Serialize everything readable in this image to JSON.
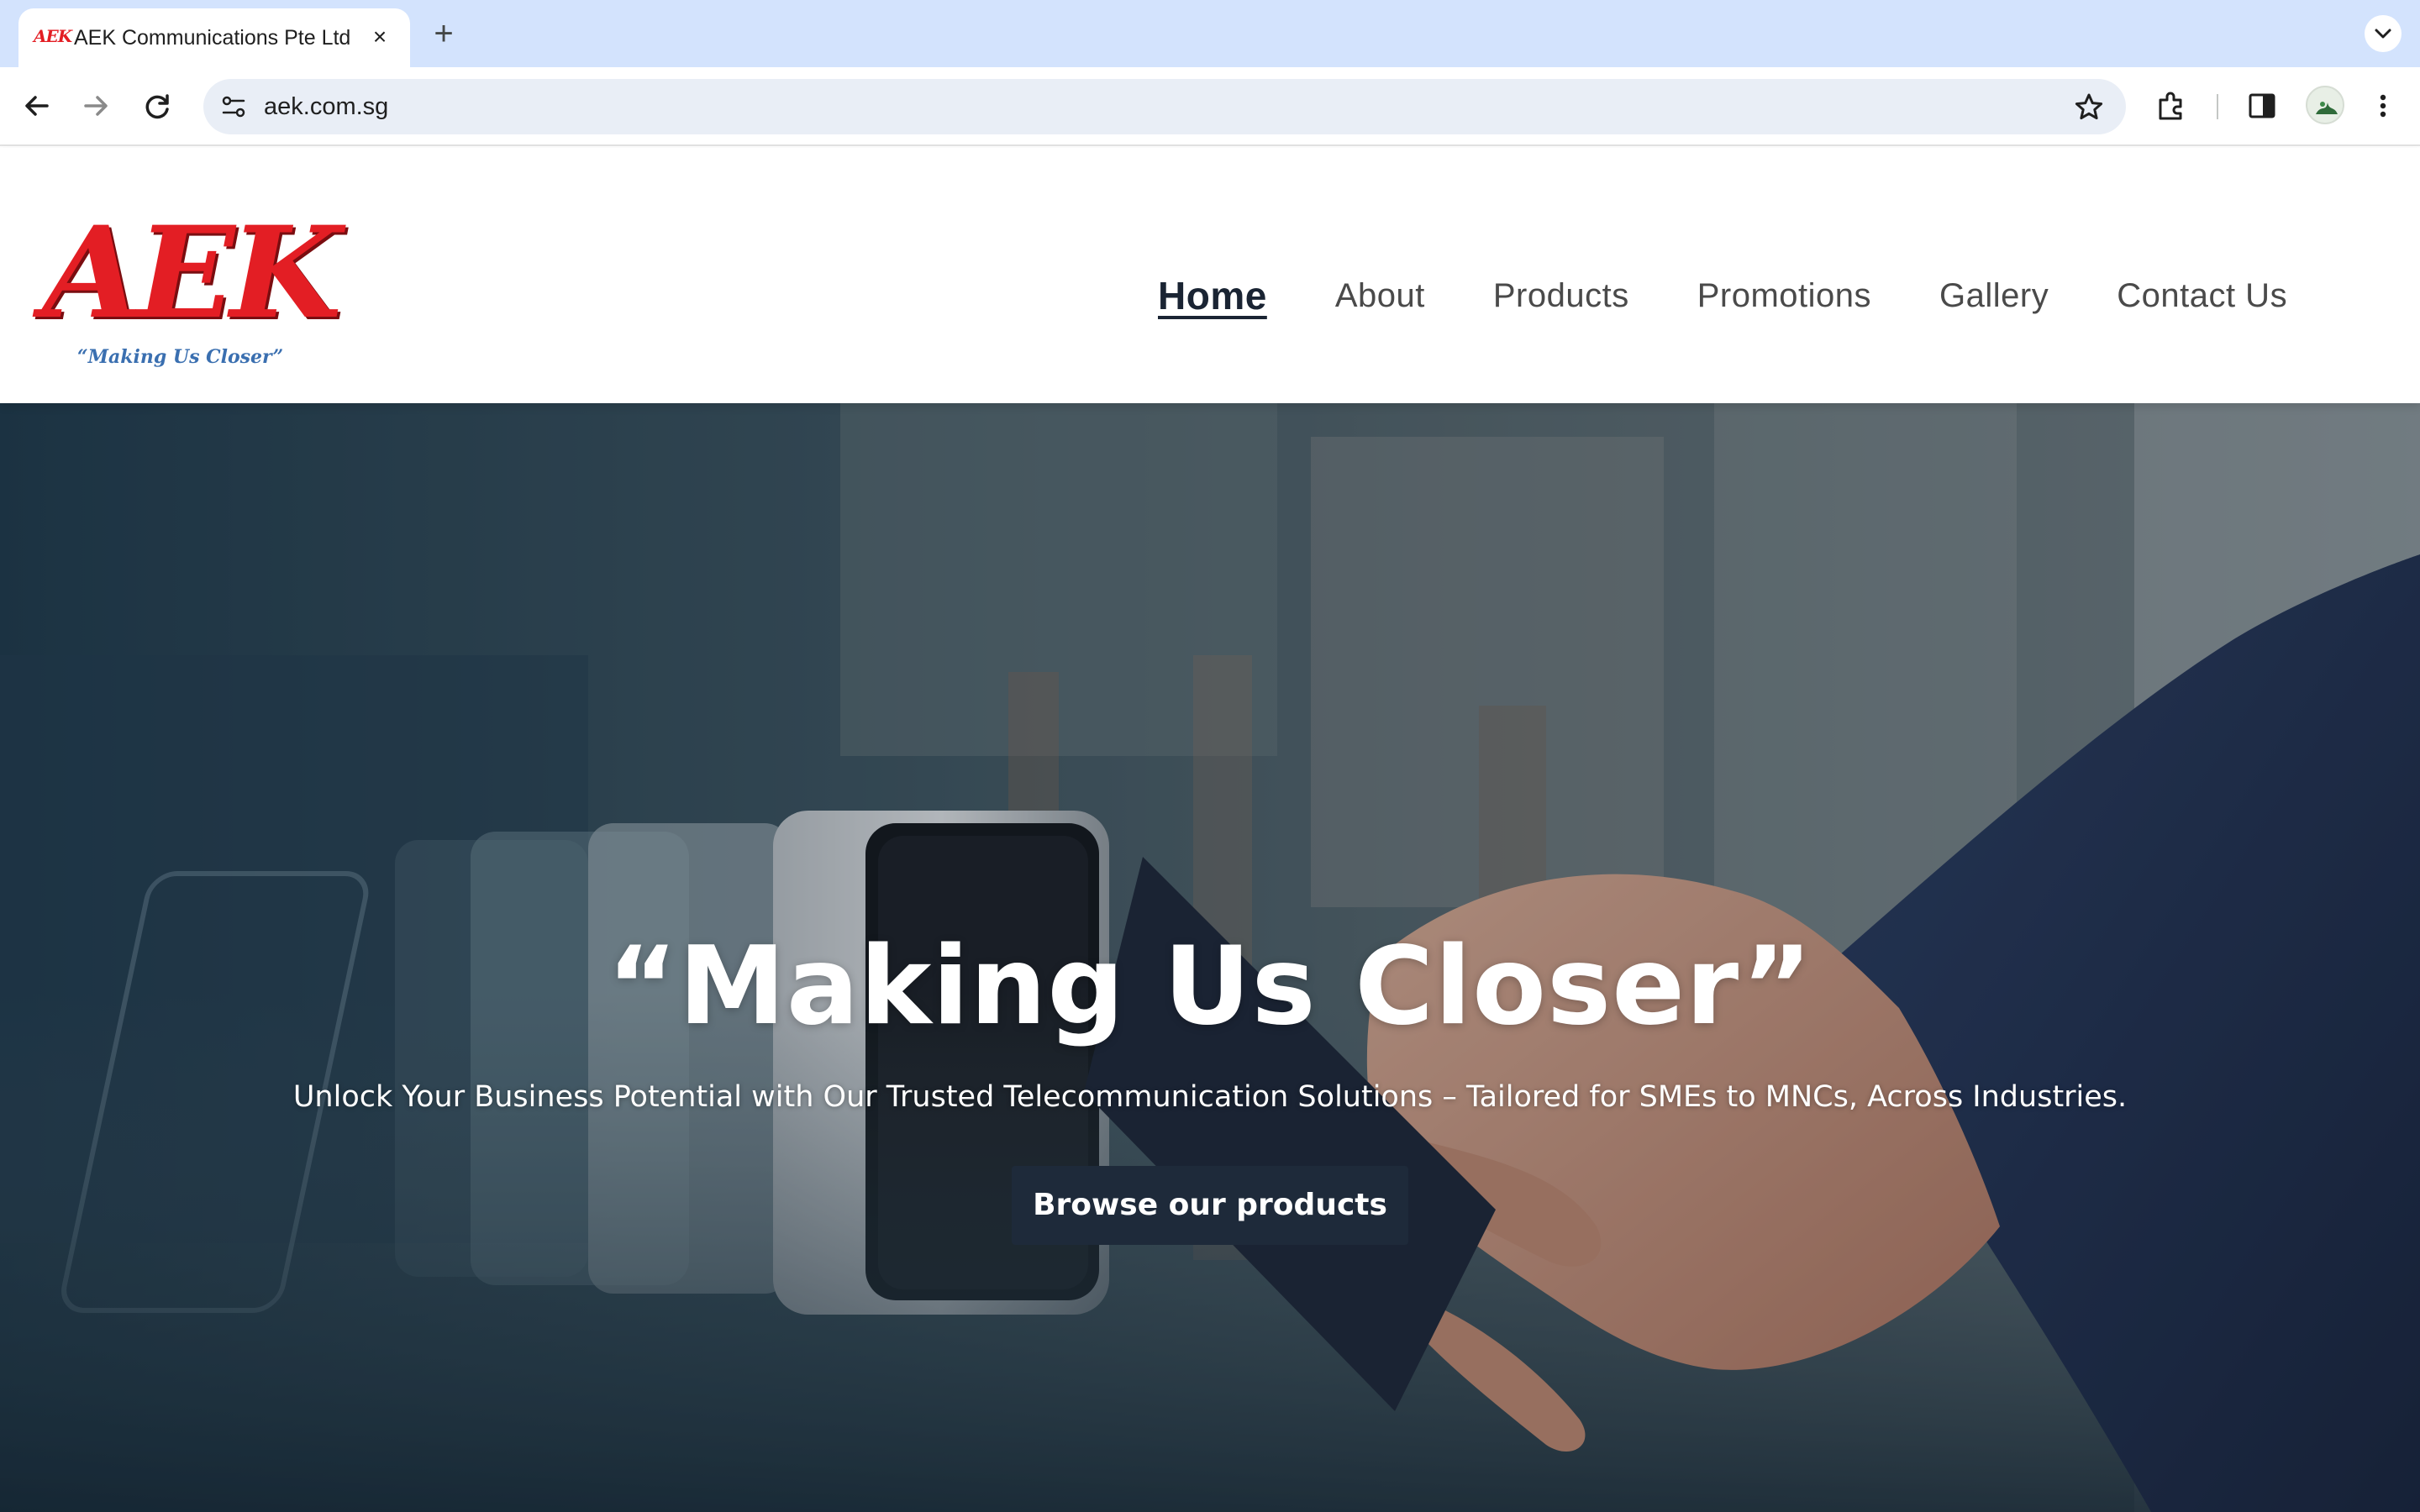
{
  "browser": {
    "tab": {
      "title": "AEK Communications Pte Ltd",
      "favicon_text": "AEK",
      "close_icon": "close-icon"
    },
    "new_tab_icon": "plus-icon",
    "url": "aek.com.sg",
    "icons": [
      "back-arrow-icon",
      "forward-arrow-icon",
      "reload-icon",
      "site-info-icon",
      "bookmark-star-icon",
      "extensions-icon",
      "side-panel-icon",
      "profile-avatar",
      "kebab-menu-icon",
      "tab-search-chevron-icon"
    ]
  },
  "site": {
    "logo": {
      "mark": "AEK",
      "tagline": "“Making Us Closer”",
      "color": "#e31e24",
      "tagline_color": "#3a6fb0"
    },
    "nav": {
      "home": "Home",
      "about": "About",
      "products": "Products",
      "promotions": "Promotions",
      "gallery": "Gallery",
      "contact": "Contact Us",
      "active": "Home"
    }
  },
  "hero": {
    "title": "“Making Us Closer”",
    "subtitle": "Unlock Your Business Potential with Our Trusted Telecommunication Solutions – Tailored for SMEs to MNCs, Across Industries.",
    "cta": "Browse our products",
    "cta_color": "#1e2a3a"
  }
}
